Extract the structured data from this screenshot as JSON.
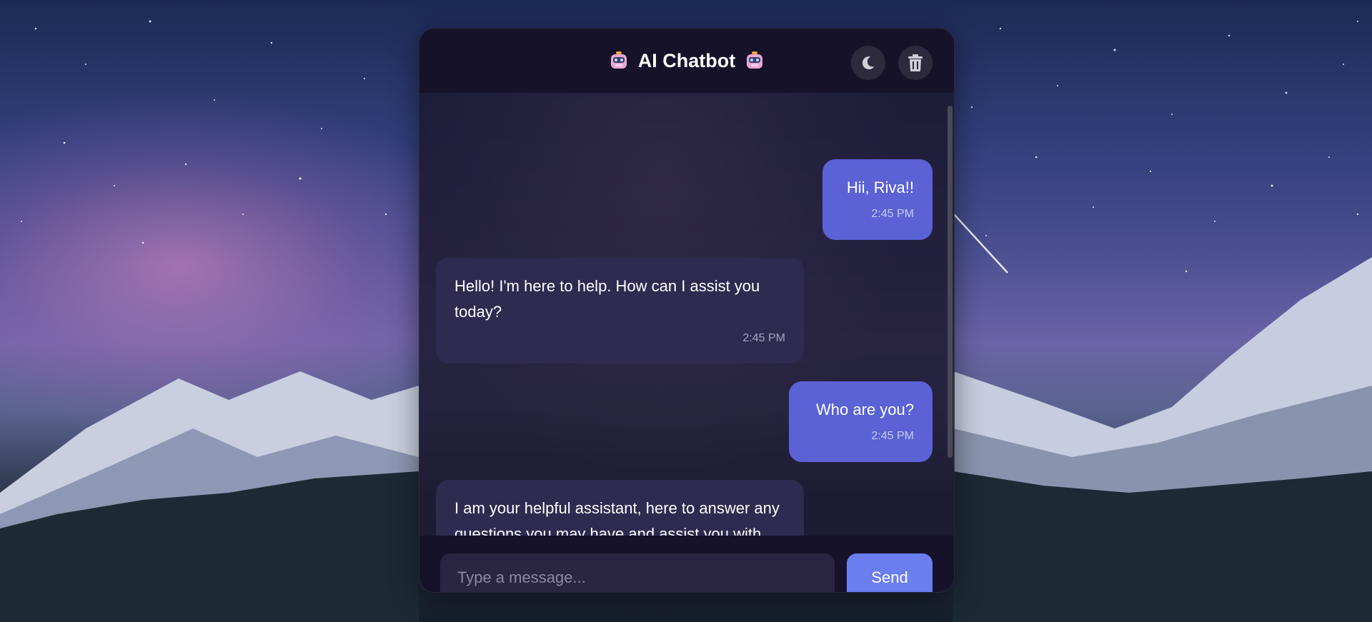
{
  "header": {
    "title": "AI Chatbot",
    "left_icon": "robot-icon",
    "right_icon": "robot-icon",
    "theme_icon": "moon-icon",
    "clear_icon": "trash-icon"
  },
  "messages": [
    {
      "role": "user",
      "text": "Hii, Riva!!",
      "time": "2:45 PM"
    },
    {
      "role": "bot",
      "text": "Hello! I'm here to help. How can I assist you today?",
      "time": "2:45 PM"
    },
    {
      "role": "user",
      "text": "Who are you?",
      "time": "2:45 PM"
    },
    {
      "role": "bot",
      "text": "I am your helpful assistant, here to answer any questions you may have and assist you with tasks. How can I help you today?",
      "time": ""
    }
  ],
  "composer": {
    "placeholder": "Type a message...",
    "value": "",
    "send_label": "Send"
  },
  "colors": {
    "user_bubble": "#5a62d6",
    "bot_bubble": "#2f2a50",
    "send_button": "#6a7ef0",
    "header_bg": "#16122a"
  }
}
